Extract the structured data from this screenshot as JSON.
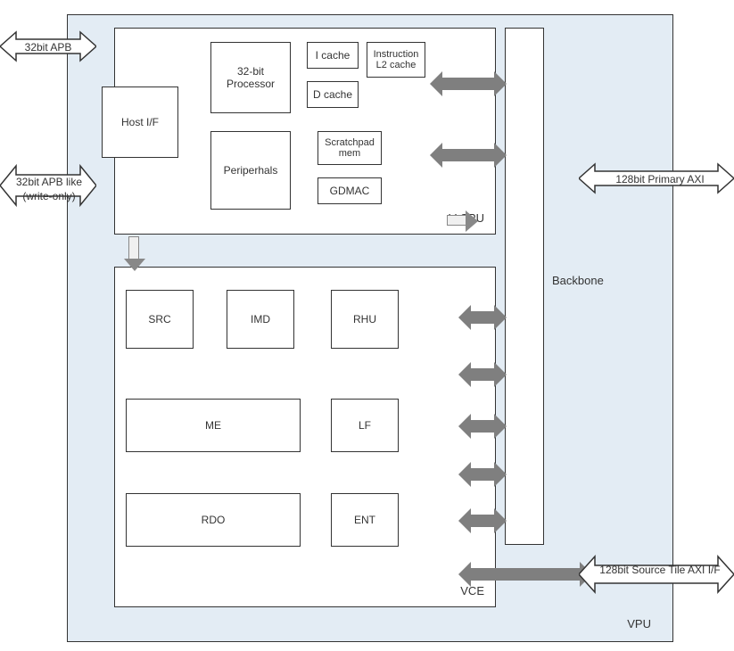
{
  "vpu": {
    "label": "VPU"
  },
  "vcpu": {
    "label": "V-CPU",
    "host_if": "Host I/F",
    "proc": "32-bit Processor",
    "icache": "I cache",
    "dcache": "D cache",
    "il2cache": "Instruction L2 cache",
    "peripherals": "Periperhals",
    "scratchpad": "Scratchpad mem",
    "gdmac": "GDMAC"
  },
  "vce": {
    "label": "VCE",
    "src": "SRC",
    "imd": "IMD",
    "rhu": "RHU",
    "me": "ME",
    "lf": "LF",
    "rdo": "RDO",
    "ent": "ENT"
  },
  "backbone": {
    "label": "Backbone"
  },
  "external": {
    "apb": "32bit APB",
    "apb_like": "32bit APB like (write-only)",
    "primary_axi": "128bit Primary AXI",
    "source_tile_axi": "128bit Source Tile AXI I/F"
  }
}
